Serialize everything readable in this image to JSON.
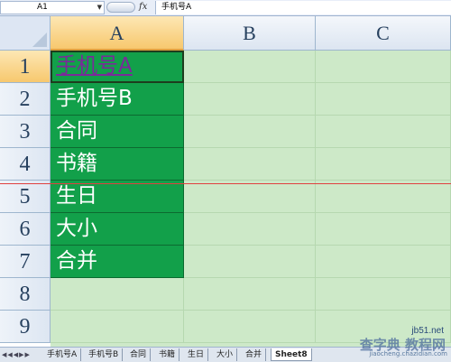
{
  "formula_bar": {
    "name_box": "A1",
    "fx_label": "fx",
    "formula_value": "手机号A"
  },
  "columns": [
    "A",
    "B",
    "C"
  ],
  "rows": [
    "1",
    "2",
    "3",
    "4",
    "5",
    "6",
    "7",
    "8",
    "9"
  ],
  "cells_a": [
    "手机号A",
    "手机号B",
    "合同",
    "书籍",
    "生日",
    "大小",
    "合并"
  ],
  "sheet_tabs": [
    "手机号A",
    "手机号B",
    "合同",
    "书籍",
    "生日",
    "大小",
    "合并",
    "Sheet8"
  ],
  "active_tab": "Sheet8",
  "colors": {
    "fill_green": "#12a04a",
    "grid_bg": "#cde9c8",
    "header_active": "#f7c86e",
    "selected_text": "#7a2a9a"
  },
  "watermark": {
    "site": "jb51.net",
    "brand": "查字典 教程网",
    "url": "jiaocheng.chazidian.com"
  }
}
